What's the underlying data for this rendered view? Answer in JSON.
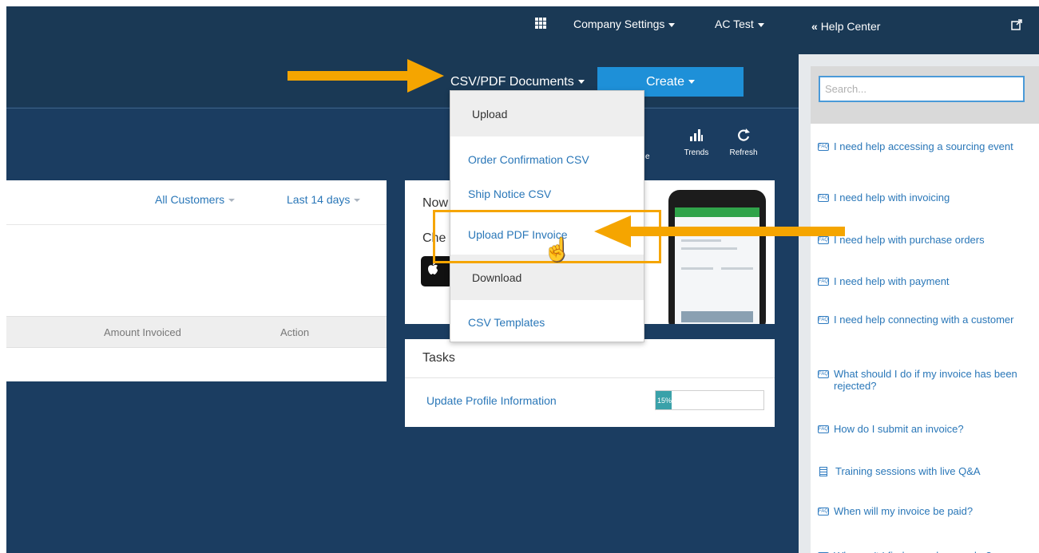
{
  "topbar": {
    "company_settings": "Company Settings",
    "account": "AC Test",
    "csv_pdf_documents": "CSV/PDF Documents",
    "create": "Create"
  },
  "toolbar": {
    "partial_label": "e",
    "trends": "Trends",
    "refresh": "Refresh"
  },
  "left_panel": {
    "filter_customers": "All Customers",
    "filter_period": "Last 14 days",
    "columns": [
      "Amount Invoiced",
      "Action"
    ]
  },
  "now_panel": {
    "title": "Now",
    "subtitle": "Che"
  },
  "tasks": {
    "title": "Tasks",
    "items": [
      {
        "label": "Update Profile Information",
        "progress_label": "15%",
        "progress": 0.15
      }
    ]
  },
  "dropdown": {
    "upload_header": "Upload",
    "items": [
      "Order Confirmation CSV",
      "Ship Notice CSV",
      "Upload PDF Invoice"
    ],
    "download_header": "Download",
    "download_items": [
      "CSV Templates"
    ]
  },
  "help": {
    "title": "Help Center",
    "search_placeholder": "Search...",
    "items": [
      {
        "icon": "faq-icon",
        "text": "I need help accessing a sourcing event"
      },
      {
        "icon": "faq-icon",
        "text": "I need help with invoicing"
      },
      {
        "icon": "faq-icon",
        "text": "I need help with purchase orders"
      },
      {
        "icon": "faq-icon",
        "text": "I need help with payment"
      },
      {
        "icon": "faq-icon",
        "text": "I need help connecting with a customer"
      },
      {
        "icon": "faq-icon",
        "text": "What should I do if my invoice has been rejected?"
      },
      {
        "icon": "faq-icon",
        "text": "How do I submit an invoice?"
      },
      {
        "icon": "document-icon",
        "text": "Training sessions with live Q&A"
      },
      {
        "icon": "faq-icon",
        "text": "When will my invoice be paid?"
      },
      {
        "icon": "faq-icon",
        "text": "Why can't I find a purchase order?"
      }
    ]
  },
  "colors": {
    "navy": "#1a3955",
    "page_blue": "#1b3d61",
    "accent_blue": "#1e90d8",
    "link_blue": "#2a77b8",
    "annotation_orange": "#f5a500"
  }
}
